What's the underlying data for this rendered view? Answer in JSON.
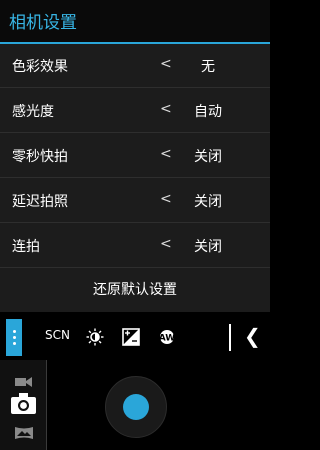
{
  "header": {
    "title": "相机设置"
  },
  "settings": {
    "rows": [
      {
        "label": "色彩效果",
        "arrow": "<",
        "value": "无"
      },
      {
        "label": "感光度",
        "arrow": "<",
        "value": "自动"
      },
      {
        "label": "零秒快拍",
        "arrow": "<",
        "value": "关闭"
      },
      {
        "label": "延迟拍照",
        "arrow": "<",
        "value": "关闭"
      },
      {
        "label": "连拍",
        "arrow": "<",
        "value": "关闭"
      }
    ],
    "reset_label": "还原默认设置"
  },
  "toolbar": {
    "scn_label": "SCN",
    "wb_label": "AW",
    "collapse_glyph": "❮"
  },
  "colors": {
    "accent": "#2aa6d9",
    "panel": "#1c1c1c"
  },
  "icons": [
    "menu-icon",
    "scene-mode-icon",
    "brightness-icon",
    "exposure-icon",
    "white-balance-icon",
    "collapse-chevron-icon",
    "video-mode-icon",
    "camera-mode-icon",
    "panorama-mode-icon"
  ]
}
